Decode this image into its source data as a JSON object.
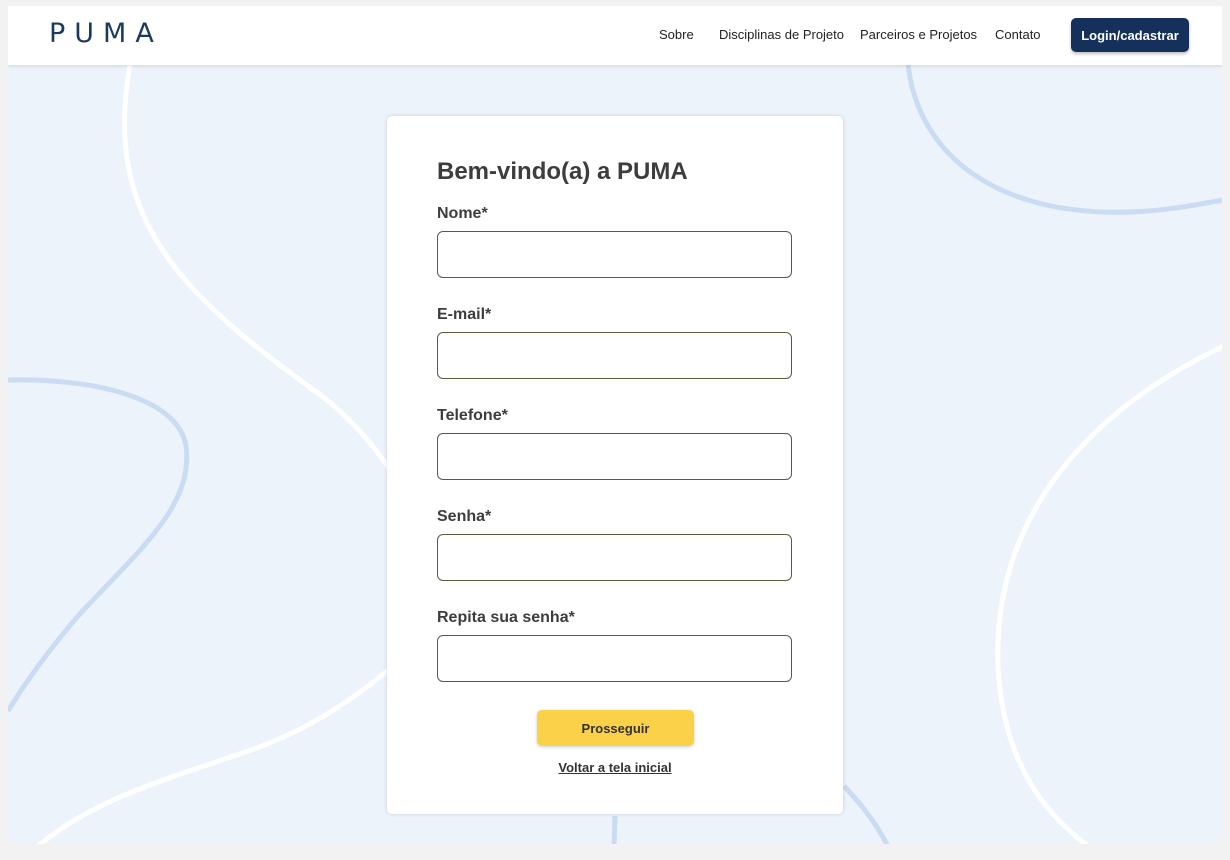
{
  "brand": {
    "logo": "PUMA"
  },
  "nav": {
    "links": [
      "Sobre",
      "Disciplinas de Projeto",
      "Parceiros e Projetos",
      "Contato"
    ],
    "login_label": "Login/cadastrar"
  },
  "form": {
    "title": "Bem-vindo(a) a PUMA",
    "fields": [
      {
        "label": "Nome*",
        "value": ""
      },
      {
        "label": "E-mail*",
        "value": ""
      },
      {
        "label": "Telefone*",
        "value": ""
      },
      {
        "label": "Senha*",
        "value": ""
      },
      {
        "label": "Repita sua senha*",
        "value": ""
      }
    ],
    "submit_label": "Prosseguir",
    "back_label": "Voltar a tela inicial"
  },
  "colors": {
    "background": "#ecf3fb",
    "navy": "#15305a",
    "accent_yellow": "#fcd14a",
    "wave_blue": "#cadcf3"
  }
}
